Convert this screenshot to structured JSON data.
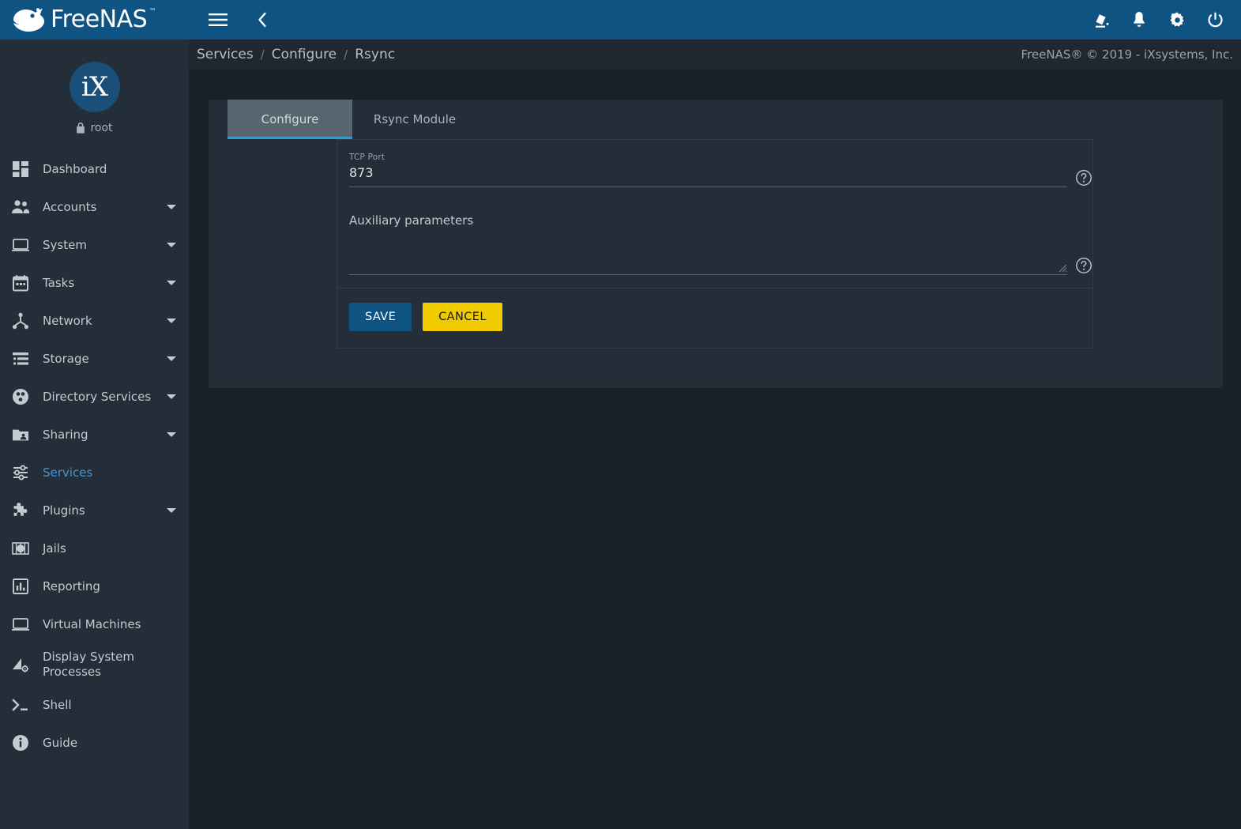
{
  "brand": {
    "name": "FreeNAS",
    "trademark": "™",
    "logo_icon": "freenas-fish-logo-icon"
  },
  "user": {
    "avatar_text": "iX",
    "name": "root",
    "lock_icon": "lock-icon"
  },
  "sidebar": {
    "items": [
      {
        "label": "Dashboard",
        "icon": "dashboard-icon",
        "expandable": false,
        "active": false
      },
      {
        "label": "Accounts",
        "icon": "accounts-people-icon",
        "expandable": true,
        "active": false
      },
      {
        "label": "System",
        "icon": "system-laptop-icon",
        "expandable": true,
        "active": false
      },
      {
        "label": "Tasks",
        "icon": "tasks-calendar-icon",
        "expandable": true,
        "active": false
      },
      {
        "label": "Network",
        "icon": "network-nodes-icon",
        "expandable": true,
        "active": false
      },
      {
        "label": "Storage",
        "icon": "storage-list-icon",
        "expandable": true,
        "active": false
      },
      {
        "label": "Directory Services",
        "icon": "directory-services-icon",
        "expandable": true,
        "active": false
      },
      {
        "label": "Sharing",
        "icon": "sharing-folder-icon",
        "expandable": true,
        "active": false
      },
      {
        "label": "Services",
        "icon": "services-sliders-icon",
        "expandable": false,
        "active": true
      },
      {
        "label": "Plugins",
        "icon": "plugins-puzzle-icon",
        "expandable": true,
        "active": false
      },
      {
        "label": "Jails",
        "icon": "jails-icon",
        "expandable": false,
        "active": false
      },
      {
        "label": "Reporting",
        "icon": "reporting-barchart-icon",
        "expandable": false,
        "active": false
      },
      {
        "label": "Virtual Machines",
        "icon": "virtual-machines-laptop-icon",
        "expandable": false,
        "active": false
      },
      {
        "label": "Display System Processes",
        "icon": "display-system-processes-icon",
        "expandable": false,
        "active": false
      },
      {
        "label": "Shell",
        "icon": "shell-prompt-icon",
        "expandable": false,
        "active": false
      },
      {
        "label": "Guide",
        "icon": "guide-info-icon",
        "expandable": false,
        "active": false
      }
    ]
  },
  "topbar": {
    "menu_toggle_icon": "hamburger-menu-icon",
    "collapse_icon": "chevron-left-icon",
    "right_icons": [
      {
        "name": "theme-paint-fill-icon"
      },
      {
        "name": "notifications-bell-icon"
      },
      {
        "name": "settings-gear-icon"
      },
      {
        "name": "power-icon"
      }
    ]
  },
  "breadcrumb": {
    "items": [
      "Services",
      "Configure",
      "Rsync"
    ],
    "separator": "/",
    "copyright": "FreeNAS® © 2019 - iXsystems, Inc."
  },
  "main": {
    "tabs": [
      {
        "label": "Configure",
        "active": true
      },
      {
        "label": "Rsync Module",
        "active": false
      }
    ],
    "form": {
      "tcp_port": {
        "label": "TCP Port",
        "value": "873",
        "placeholder": "",
        "help_icon": "help-circle-icon"
      },
      "auxiliary_parameters": {
        "label": "Auxiliary parameters",
        "value": "",
        "placeholder": "Auxiliary parameters",
        "help_icon": "help-circle-icon",
        "resize_handle_icon": "textarea-resize-grip-icon"
      }
    },
    "buttons": {
      "save_label": "SAVE",
      "cancel_label": "CANCEL"
    }
  },
  "colors": {
    "header_blue": "#0f5382",
    "sidebar_bg": "#242e38",
    "page_bg": "#1a2027",
    "card_bg": "#242e38",
    "active_tab_bg": "#56656e",
    "tab_underline": "#16a3e8",
    "active_nav_text": "#4a93d1",
    "save_button": "#0f5382",
    "cancel_button": "#f0cb00"
  }
}
